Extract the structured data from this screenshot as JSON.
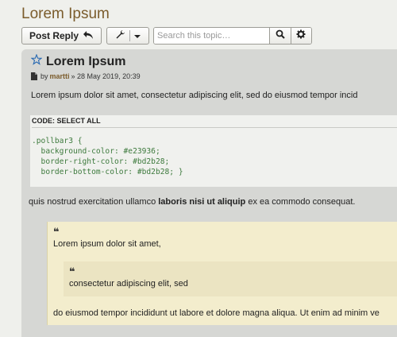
{
  "topic": {
    "title": "Lorem Ipsum"
  },
  "toolbar": {
    "post_reply_label": "Post Reply",
    "icons": {
      "reply": "reply-icon",
      "tools": "wrench-icon",
      "dropdown": "caret-down-icon",
      "search": "search-icon",
      "advanced": "gear-icon"
    }
  },
  "search": {
    "placeholder": "Search this topic…",
    "value": ""
  },
  "post": {
    "title": "Lorem Ipsum",
    "meta": {
      "by": "by",
      "author": "martti",
      "date": "» 28 May 2019, 20:39"
    },
    "text1": "Lorem ipsum dolor sit amet, consectetur adipiscing elit, sed do eiusmod tempor incid",
    "codebox": {
      "header": "CODE:",
      "select_all": "SELECT ALL",
      "lines": [
        ".pollbar3 {",
        "  background-color: #e23936;",
        "  border-right-color: #bd2b28;",
        "  border-bottom-color: #bd2b28; }"
      ]
    },
    "text2": {
      "before": "quis nostrud exercitation ullamco ",
      "bold": "laboris nisi ut aliquip",
      "after": " ex ea commodo consequat."
    },
    "quote": {
      "mark": "❝",
      "text1": "Lorem ipsum dolor sit amet,",
      "inner": {
        "mark": "❝",
        "text": "consectetur adipiscing elit, sed"
      },
      "text2": "do eiusmod tempor incididunt ut labore et dolore magna aliqua. Ut enim ad minim ve"
    }
  },
  "colors": {
    "title": "#7b5c2c",
    "author": "#7b5c2c",
    "code_text": "#3d7a3d",
    "quote_bg": "#f3edcd",
    "inner_quote_bg": "#ebe4c2",
    "post_bg": "#d6d7d4",
    "page_bg": "#eff0ec"
  }
}
